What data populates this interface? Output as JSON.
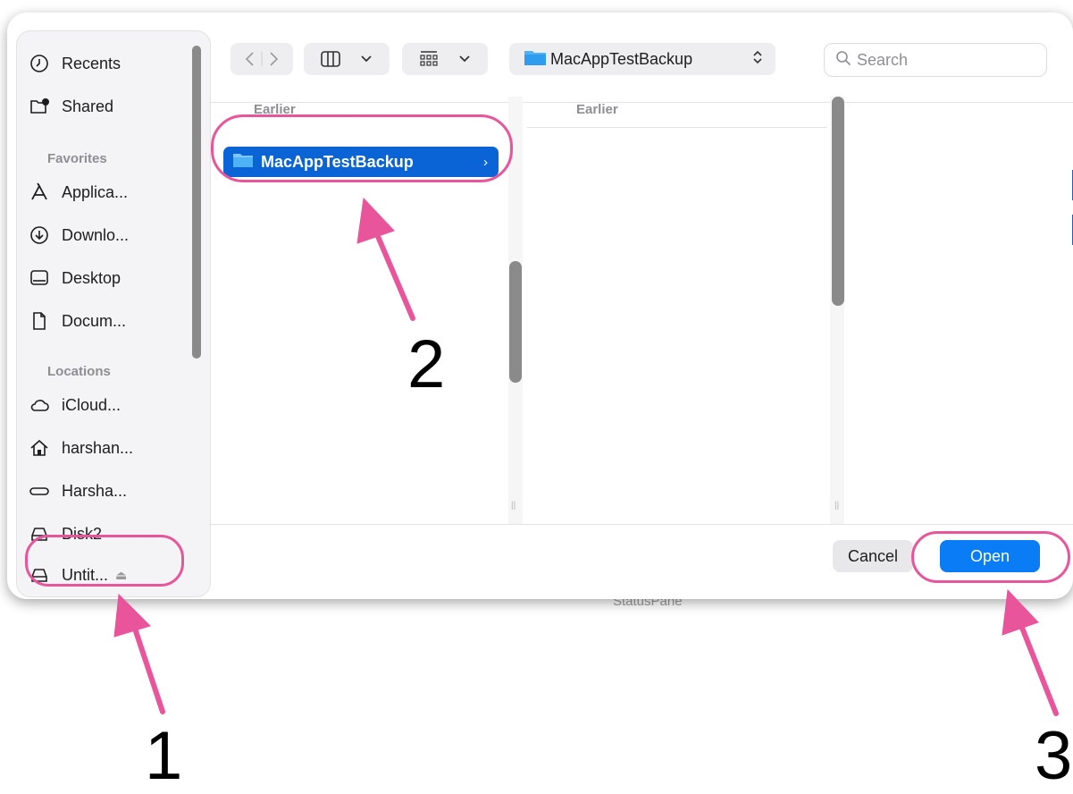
{
  "sidebar": {
    "items_top": [
      {
        "label": "Recents",
        "icon": "clock-icon"
      },
      {
        "label": "Shared",
        "icon": "shared-folder-icon"
      }
    ],
    "favorites_heading": "Favorites",
    "favorites": [
      {
        "label": "Applica...",
        "icon": "applications-icon"
      },
      {
        "label": "Downlo...",
        "icon": "download-icon"
      },
      {
        "label": "Desktop",
        "icon": "desktop-icon"
      },
      {
        "label": "Docum...",
        "icon": "document-icon"
      }
    ],
    "locations_heading": "Locations",
    "locations": [
      {
        "label": "iCloud...",
        "icon": "cloud-icon"
      },
      {
        "label": "harshan...",
        "icon": "home-icon"
      },
      {
        "label": "Harsha...",
        "icon": "drive-icon"
      },
      {
        "label": "Disk2",
        "icon": "external-disk-icon"
      },
      {
        "label": "Untit...",
        "icon": "external-disk-icon",
        "eject": "⏏"
      }
    ]
  },
  "toolbar": {
    "path_label": "MacAppTestBackup",
    "search_placeholder": "Search"
  },
  "browser": {
    "column1_heading": "Earlier",
    "column2_heading": "Earlier",
    "selected_item": "MacAppTestBackup"
  },
  "footer": {
    "cancel_label": "Cancel",
    "open_label": "Open"
  },
  "background_text": "StatusPane",
  "annotations": {
    "step1": "1",
    "step2": "2",
    "step3": "3",
    "color": "#e8559b"
  }
}
